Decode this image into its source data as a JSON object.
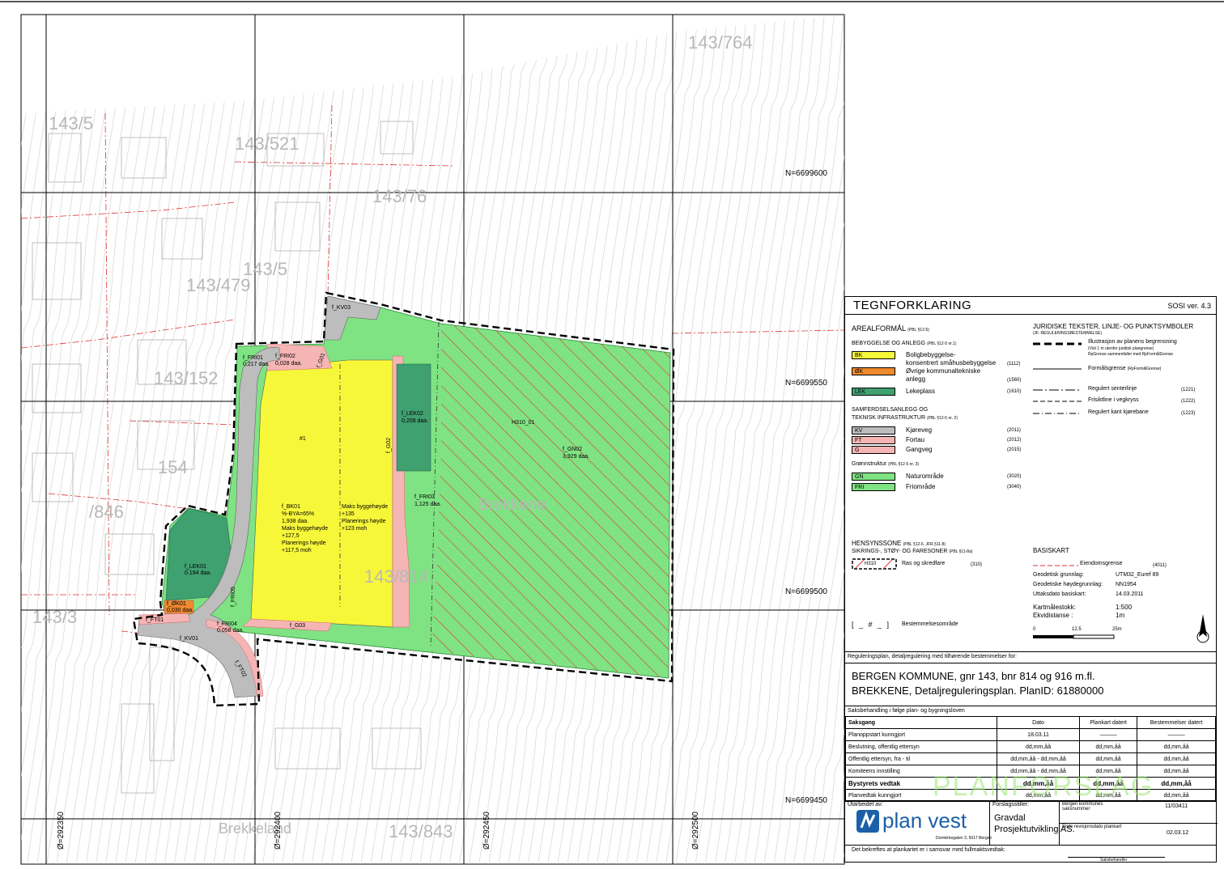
{
  "colors": {
    "green": "#7fe383",
    "yellow": "#f7f73a",
    "road": "#bdbdbd",
    "pink": "#f5b5b5",
    "darkgreen": "#3fa070",
    "orange": "#f08a2e",
    "hatch": "#e53333"
  },
  "coords": {
    "north": [
      "N=6699600",
      "N=6699550",
      "N=6699500",
      "N=6699450"
    ],
    "east": [
      "Ø=292350",
      "Ø=292400",
      "Ø=292450",
      "Ø=292500"
    ]
  },
  "map_labels": {
    "fri01": "f_FRI01",
    "fri01_area": "0,217 daa.",
    "frip2": "f_FRI02",
    "frip2_area": "0,028 daa.",
    "kv03": "f_KV03",
    "lek01": "f_LEK01",
    "lek01_area": "0.194 daa.",
    "ok01": "f_ØK01",
    "ok01_area": "0,030 daa.",
    "lek02": "f_LEK02",
    "lek02_area": "0,209 daa.",
    "bk01_id": "#1",
    "bk01": "f_BK01",
    "bk01_a": "%-BYA=65%",
    "bk01_b": "1,938 daa.",
    "bk01_c": "Maks byggehøyde",
    "bk01_d": "+127,5",
    "bk01_e": "Planerings høyde",
    "bk01_f": "+117,5 moh",
    "maks": "Maks byggehøyde",
    "maks_v": "+135",
    "plan": "Planerings høyde",
    "plan_v": "+123 moh",
    "fri03": "f_FRI03",
    "fri03_area": "1,125 daa.",
    "gn02": "f_GN02",
    "gn02_area": "3,929 daa.",
    "h310": "H310_01",
    "brekkene": "Brekkene",
    "brekkeland": "Brekkeland",
    "g01": "f_G01",
    "g02": "f_G02",
    "g03": "f_G03",
    "kv01": "f_KV01",
    "ft01": "f_FT01",
    "ft02": "f_FT02",
    "fri04": "f_FRI04",
    "fri04_area": "0,058 daa.",
    "fri05": "f_FRI05",
    "p143_764": "143/764",
    "p143_521": "143/521",
    "p143_5": "143/5",
    "p143_76": "143/76",
    "p143_479": "143/479",
    "p143_152": "143/152",
    "p143_814": "143/814",
    "p143_843": "143/843",
    "p143_3": "143/3",
    "p143_846": "/846",
    "p143_15": "154"
  },
  "legend": {
    "title": "TEGNFORKLARING",
    "sosi": "SOSI ver. 4.3",
    "arealformal": "AREALFORMÅL",
    "arealformal_ref": "(PBL §12-5)",
    "bebyggelse": "BEBYGGELSE OG ANLEGG",
    "bebyggelse_ref": "(PBL §12-5 nr.1)",
    "items_bebyggelse": [
      {
        "code": "BK",
        "label": "Boligbebyggelse-",
        "label2": "konsentrert småhusbebyggelse",
        "num": "(1112)"
      },
      {
        "code": "ØK",
        "label": "Øvrige kommunaltekniske",
        "label2": "anlegg",
        "num": "(1560)"
      },
      {
        "code": "LEK",
        "label": "Lekeplass",
        "label2": "",
        "num": "(1610)"
      }
    ],
    "samferdsel": "SAMFERDSELSANLEGG OG",
    "samferdsel2": "TEKNISK INFRASTRUKTUR",
    "samferdsel_ref": "(PBL §12-5 nr. 2)",
    "items_samferdsel": [
      {
        "code": "KV",
        "label": "Kjøreveg",
        "num": "(2011)"
      },
      {
        "code": "FT",
        "label": "Fortau",
        "num": "(2012)"
      },
      {
        "code": "G",
        "label": "Gangveg",
        "num": "(2015)"
      }
    ],
    "gronn": "Grønnstruktur",
    "gronn_ref": "(PBL §12-5 nr. 3)",
    "items_gronn": [
      {
        "code": "GN",
        "label": "Naturområde",
        "num": "(3020)"
      },
      {
        "code": "FRI",
        "label": "Friområde",
        "num": "(3040)"
      }
    ],
    "juridiske": "JURIDISKE TEKSTER, LINJE- OG PUNKTSYMBOLER",
    "juridiske_ref": "(JF. REGULERINGSBESTEMMELSE)",
    "illustrasjon": "Illustrasjon av planens begrensning",
    "illustrasjon2": "(Vist 1 m utenfor juridisk plangrense)",
    "illustrasjon3": "RpGrense sammenfaller med RpFormålGrense",
    "formalsgrense": "Formålsgrense",
    "formalsgrense_ref": "(RpFormålGrense)",
    "senterlinje": "Regulert senterlinje",
    "senterlinje_n": "(1221)",
    "frisikt": "Frisiktline i vegkryss",
    "frisikt_n": "(1222)",
    "kant": "Regulert kant kjørebane",
    "kant_n": "(1223)",
    "hensyn": "HENSYNSSONE",
    "hensyn_ref": "(PBL §12-6, JFR.§11-8)",
    "sikrings": "SIKRINGS-, STØY- OG FARESONER",
    "sikrings_ref": "(PBL §11-8a)",
    "h310": "H310",
    "ras": "Ras og skredfare",
    "ras_n": "(310)",
    "bestemmelse": "Bestemmelsesområde",
    "basiskart": "BASISKART",
    "eiendom": "Eiendomsgrense",
    "eiendom_n": "(4011)",
    "geo1_k": "Geodetisk grunnlag:",
    "geo1_v": "UTM32_Euref 89",
    "geo2_k": "Geodetiske høydegrunnlag:",
    "geo2_v": "NN1954",
    "geo3_k": "Uttaksdato basiskart:",
    "geo3_v": "14.03.2011",
    "skala_k": "Kartmålestokk:",
    "skala_v": "1:500",
    "ekvi_k": "Ekvidistanse :",
    "ekvi_v": "1m",
    "scale_0": "0",
    "scale_1": "12.5",
    "scale_2": "25m",
    "regplan": "Reguleringsplan, detaljregulering med tilhørende bestemmelser for:",
    "plan1": "BERGEN KOMMUNE, gnr 143, bnr 814 og 916 m.fl.",
    "plan2": "BREKKENE, Detaljreguleringsplan. PlanID: 61880000",
    "saksbeh": "Saksbehandling i følge plan- og bygningsloven",
    "table_head": [
      "Saksgang",
      "Dato",
      "Plankart datert",
      "Bestemmelser datert"
    ],
    "table_rows": [
      [
        "Planoppstart kunngjort",
        "18.03.11",
        "",
        ""
      ],
      [
        "Beslutning, offentlig ettersyn",
        "dd,mm,åå",
        "dd,mm,åå",
        "dd,mm,åå"
      ],
      [
        "Offentlig ettersyn, fra - til",
        "dd,mm,åå - dd,mm,åå",
        "dd,mm,åå",
        "dd,mm,åå"
      ],
      [
        "Komiteens innstilling",
        "dd,mm,åå - dd,mm,åå",
        "dd,mm,åå",
        "dd,mm,åå"
      ],
      [
        "Bystyrets vedtak",
        "dd,mm,åå",
        "dd,mm,åå",
        "dd,mm,åå"
      ],
      [
        "Planvedtak kunngjort",
        "dd,mm,åå",
        "dd,mm,åå",
        "dd,mm,åå"
      ]
    ],
    "utarbeidet": "Utarbeidet av:",
    "logo_text": "plan vest",
    "address": "Domkirkegaten 3, 5017 Bergen",
    "forslag": "Forslagsstiller:",
    "forslag_v": "Gravdal",
    "forslag_v2": "Prosjektutvikling AS.",
    "saksnr_k": "Bergen kommunes saksnummer",
    "saksnr_v": "11/03411",
    "revisjon_k": "Siste revisjonsdato plankart",
    "revisjon_v": "02.03.12",
    "bekreft": "Det bekreftes at plankartet er i samsvar med fullmaktsvedtak:",
    "sign": "Saksbehandler",
    "watermark": "PLANFORSLAG"
  }
}
